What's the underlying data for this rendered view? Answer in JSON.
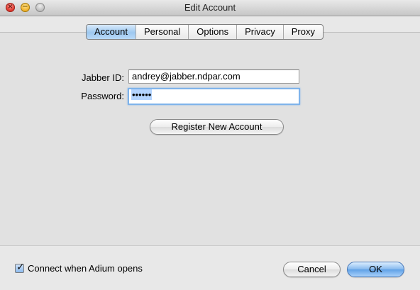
{
  "window": {
    "title": "Edit Account"
  },
  "tabs": [
    {
      "label": "Account",
      "active": true
    },
    {
      "label": "Personal",
      "active": false
    },
    {
      "label": "Options",
      "active": false
    },
    {
      "label": "Privacy",
      "active": false
    },
    {
      "label": "Proxy",
      "active": false
    }
  ],
  "form": {
    "jabber_id_label": "Jabber ID:",
    "jabber_id_value": "andrey@jabber.ndpar.com",
    "password_label": "Password:",
    "password_value": "••••••",
    "register_button": "Register New Account"
  },
  "footer": {
    "connect_label": "Connect when Adium opens",
    "connect_checked": true,
    "cancel_button": "Cancel",
    "ok_button": "OK"
  },
  "colors": {
    "accent": "#84b8ee",
    "focus_ring": "#7fb3ea",
    "selection": "#b5d5ff"
  },
  "icons": {
    "close": "close-icon",
    "minimize": "minimize-icon",
    "zoom": "zoom-icon",
    "check": "checkmark-icon"
  }
}
